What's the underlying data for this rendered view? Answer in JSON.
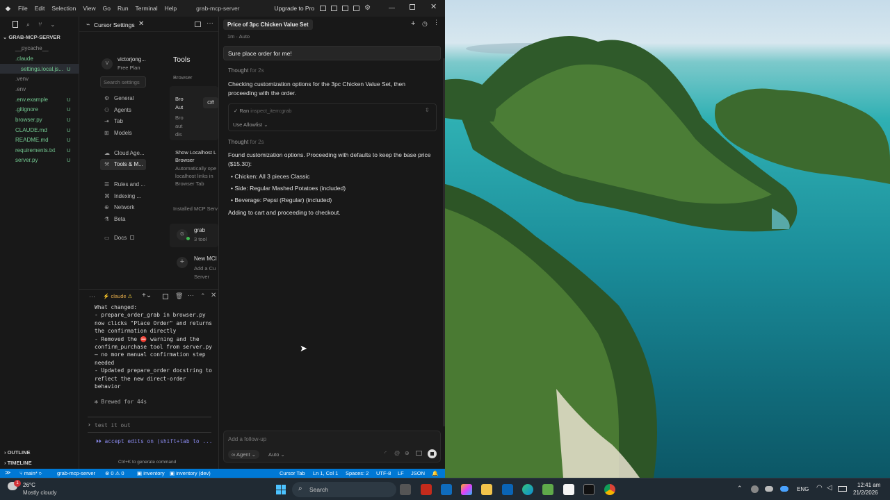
{
  "window": {
    "title": "grab-mcp-server",
    "upgrade": "Upgrade to Pro"
  },
  "menu": [
    "File",
    "Edit",
    "Selection",
    "View",
    "Go",
    "Run",
    "Terminal",
    "Help"
  ],
  "explorer": {
    "root": "GRAB-MCP-SERVER",
    "files": [
      {
        "name": "__pycache__",
        "badge": "",
        "color": "#8b8b8b"
      },
      {
        "name": ".claude",
        "badge": "",
        "color": "#73c991"
      },
      {
        "name": "settings.local.js...",
        "badge": "U",
        "color": "#73c991"
      },
      {
        "name": ".venv",
        "badge": "",
        "color": "#8b8b8b"
      },
      {
        "name": ".env",
        "badge": "",
        "color": "#8b8b8b"
      },
      {
        "name": ".env.example",
        "badge": "U",
        "color": "#73c991"
      },
      {
        "name": ".gitignore",
        "badge": "U",
        "color": "#73c991"
      },
      {
        "name": "browser.py",
        "badge": "U",
        "color": "#73c991"
      },
      {
        "name": "CLAUDE.md",
        "badge": "U",
        "color": "#73c991"
      },
      {
        "name": "README.md",
        "badge": "U",
        "color": "#73c991"
      },
      {
        "name": "requirements.txt",
        "badge": "U",
        "color": "#73c991"
      },
      {
        "name": "server.py",
        "badge": "U",
        "color": "#73c991"
      }
    ],
    "outline": "OUTLINE",
    "timeline": "TIMELINE"
  },
  "settings": {
    "tab_label": "Cursor Settings",
    "user_name": "victorjong...",
    "plan": "Free Plan",
    "avatar_letter": "V",
    "search_placeholder": "Search settings",
    "nav": [
      "General",
      "Agents",
      "Tab",
      "Models",
      "Cloud Age...",
      "Tools & M...",
      "Rules and ...",
      "Indexing ...",
      "Network",
      "Beta",
      "Docs"
    ],
    "tools_title": "Tools",
    "browser_label": "Browser",
    "browser_item_title": "Bro Aut",
    "browser_item_desc": "Bro aut dis",
    "toggle_off": "Off",
    "localhost_title": "Show Localhost L Browser",
    "localhost_desc": "Automatically ope localhost links in Browser Tab",
    "installed_label": "Installed MCP Serv",
    "mcp_letter": "G",
    "mcp_name": "grab",
    "mcp_tools": "3 tool",
    "new_mcp_title": "New MCI",
    "new_mcp_desc": "Add a Cu Server"
  },
  "terminal": {
    "tab": "claude",
    "lines": [
      "What changed:",
      "- prepare_order_grab in browser.py",
      "now clicks \"Place Order\" and returns",
      " the confirmation directly",
      "- Removed the ⛔ warning and the",
      "confirm_purchase tool from server.py",
      " — no more manual confirmation step",
      "needed",
      "- Updated prepare_order docstring to",
      " reflect the new direct-order",
      "behavior"
    ],
    "brewed": "✻ Brewed for 44s",
    "prompt": "test it out",
    "accept": "⏵⏵ accept edits on (shift+tab to ...",
    "hint": "Ctrl+K to generate command"
  },
  "chat": {
    "tab_title": "Price of 3pc Chicken Value Set",
    "meta": "1m · Auto",
    "user_message": "Sure place order for me!",
    "thought1_label": "Thought",
    "thought1_time": "for 2s",
    "text1": "Checking customization options for the 3pc Chicken Value Set, then proceeding with the order.",
    "ran_label": "Ran",
    "ran_tool": "inspect_item:grab",
    "allowlist": "Use Allowlist",
    "thought2_label": "Thought",
    "thought2_time": "for 2s",
    "text2": "Found customization options. Proceeding with defaults to keep the base price ($15.30):",
    "bullets": [
      "Chicken: All 3 pieces Classic",
      "Side: Regular Mashed Potatoes (included)",
      "Beverage: Pepsi (Regular) (included)"
    ],
    "text3": "Adding to cart and proceeding to checkout.",
    "input_placeholder": "Add a follow-up",
    "mode": "Agent",
    "model": "Auto"
  },
  "statusbar": {
    "branch": "main*",
    "project": "grab-mcp-server",
    "errors": "⊗ 0 ⚠ 0",
    "inventory": "inventory",
    "inventory_dev": "inventory (dev)",
    "cursor_tab": "Cursor Tab",
    "position": "Ln 1, Col 1",
    "spaces": "Spaces: 2",
    "encoding": "UTF-8",
    "eol": "LF",
    "language": "JSON"
  },
  "taskbar": {
    "temp": "26°C",
    "weather": "Mostly cloudy",
    "weather_badge": "1",
    "search": "Search",
    "lang": "ENG",
    "time": "12:41 am",
    "date": "21/2/2026"
  }
}
